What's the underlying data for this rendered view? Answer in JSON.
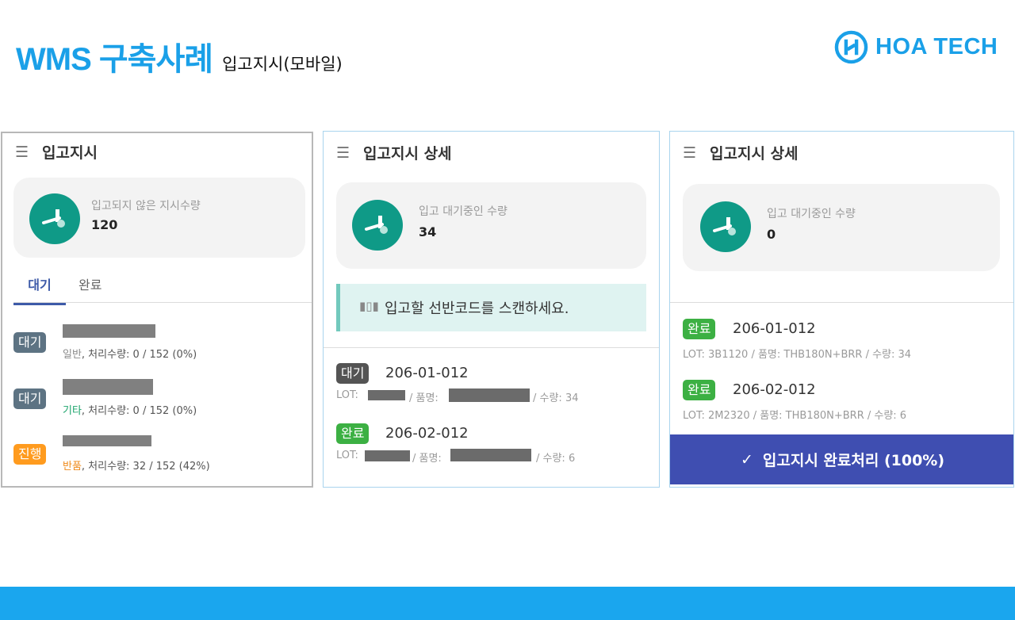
{
  "header": {
    "title": "WMS 구축사례",
    "subtitle": "입고지시(모바일)",
    "brand": "HOA TECH",
    "brand_color": "#1aa0e8"
  },
  "panel1": {
    "menu_icon": "☰",
    "title": "입고지시",
    "stat_icon": "forklift-icon",
    "stat_label": "입고되지 않은 지시수량",
    "stat_value": "120",
    "tabs": [
      "대기",
      "완료"
    ],
    "items": [
      {
        "status": "대기",
        "type": "일반",
        "progress_label": ", 처리수량: ",
        "progress": "0 / 152 (0%)",
        "status_color": "#5d7383"
      },
      {
        "status": "대기",
        "type": "기타",
        "progress_label": ", 처리수량: ",
        "progress": "0 / 152 (0%)",
        "status_color": "#5d7383"
      },
      {
        "status": "진행",
        "type": "반품",
        "progress_label": ", 처리수량: ",
        "progress": "32 / 152 (42%)",
        "status_color": "#ff9b1e"
      }
    ]
  },
  "panel2": {
    "menu_icon": "☰",
    "title": "입고지시 상세",
    "stat_label": "입고 대기중인 수량",
    "stat_value": "34",
    "scan_icon": "barcode-icon",
    "scan_message": "입고할 선반코드를 스캔하세요.",
    "items": [
      {
        "status": "대기",
        "code": "206-01-012",
        "lot_prefix": "LOT: ",
        "mid": "/ 품명:",
        "qty": "/ 수량: 34"
      },
      {
        "status": "완료",
        "code": "206-02-012",
        "lot_prefix": "LOT: ",
        "mid": "/ 품명:",
        "qty": "/ 수량: 6"
      }
    ]
  },
  "panel3": {
    "menu_icon": "☰",
    "title": "입고지시 상세",
    "stat_label": "입고 대기중인 수량",
    "stat_value": "0",
    "items": [
      {
        "status": "완료",
        "code": "206-01-012",
        "detail": "LOT: 3B1120 / 품명: THB180N+BRR / 수량: 34"
      },
      {
        "status": "완료",
        "code": "206-02-012",
        "detail": "LOT: 2M2320 / 품명: THB180N+BRR / 수량: 6"
      }
    ],
    "complete_icon": "✓",
    "complete_button": "입고지시 완료처리 (100%)",
    "button_color": "#3f4eb1"
  }
}
